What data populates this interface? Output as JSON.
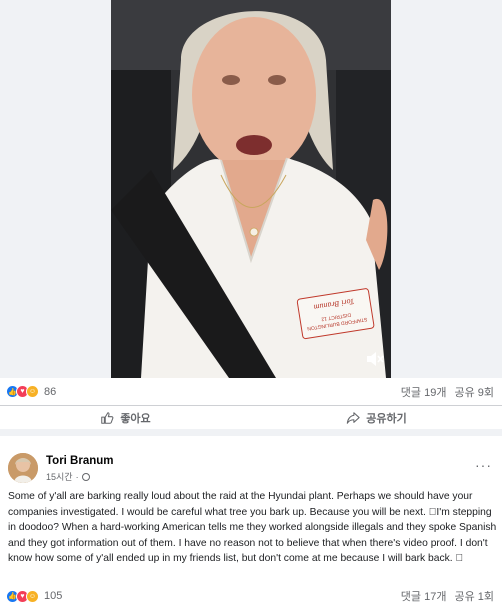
{
  "video": {
    "badge_name": "Tori Branum",
    "badge_line1": "DISTRICT 12",
    "badge_line2": "STAFFORD BURLINGTON",
    "volume_icon": "volume-icon"
  },
  "video_stats": {
    "reaction_count": "86",
    "comments": "댓글 19개",
    "shares": "공유 9회"
  },
  "actions": {
    "like_label": "좋아요",
    "share_label": "공유하기"
  },
  "post": {
    "author": "Tori Branum",
    "time": "15시간",
    "more": "···",
    "text": "Some of y'all are barking really loud about the raid at the Hyundai plant. Perhaps we should have your companies investigated. I would be careful what tree you bark up. Because you will be next. 🏻I'm stepping in doodoo?  When a  hard-working American tells me they worked alongside illegals and they spoke Spanish and they got information out of them. I have no reason not to believe that when there's video proof. I don't know how some of y'all ended up in  my friends list, but don't come at me because I will bark back. 🏻"
  },
  "post_stats": {
    "reaction_count": "105",
    "comments": "댓글 17개",
    "shares": "공유 1회"
  },
  "colors": {
    "like": "#1877f2",
    "love": "#f33e58",
    "haha": "#f7b125",
    "muted_text": "#65676b",
    "divider": "#f0f2f5"
  }
}
